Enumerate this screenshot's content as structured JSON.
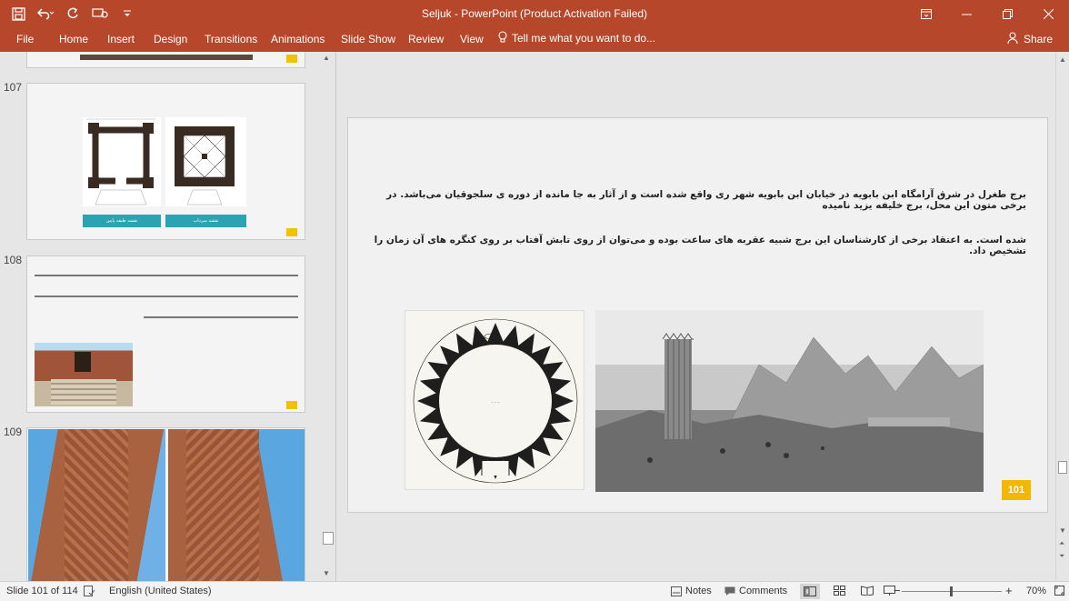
{
  "app": {
    "title": "Seljuk - PowerPoint (Product Activation Failed)",
    "accent_color": "#b7472a"
  },
  "quick_access": [
    {
      "icon": "save-icon"
    },
    {
      "icon": "undo-icon"
    },
    {
      "icon": "redo-icon"
    },
    {
      "icon": "present-icon"
    },
    {
      "icon": "customize-icon"
    }
  ],
  "ribbon": {
    "tabs": [
      "File",
      "Home",
      "Insert",
      "Design",
      "Transitions",
      "Animations",
      "Slide Show",
      "Review",
      "View"
    ],
    "tell_me": "Tell me what you want to do...",
    "share": "Share"
  },
  "thumbnails": [
    {
      "number": "107",
      "caption_left": "نقشه طبقه پایین",
      "caption_right": "نقشه سرداب"
    },
    {
      "number": "108"
    },
    {
      "number": "109"
    }
  ],
  "slide": {
    "paragraph_line1": "برج طغرل در شرق آرامگاه ابن بابویه در خیابان ابن بابویه شهر ری واقع شده است و از آثار به جا مانده از دوره ی سلجوقیان می‌باشد. در برخی متون این محل، برج خلیفه یزید نامیده",
    "paragraph_line2": "شده است. به اعتقاد برخی از کارشناسان این برج شبیه عقربه های ساعت بوده و می‌توان از روی تابش آفتاب بر روی کنگره های آن زمان را تشخیص داد.",
    "badge": "101",
    "badge_color": "#f2b700"
  },
  "status": {
    "slide_of": "Slide 101 of 114",
    "language": "English (United States)",
    "notes": "Notes",
    "comments": "Comments",
    "zoom": "70%"
  }
}
